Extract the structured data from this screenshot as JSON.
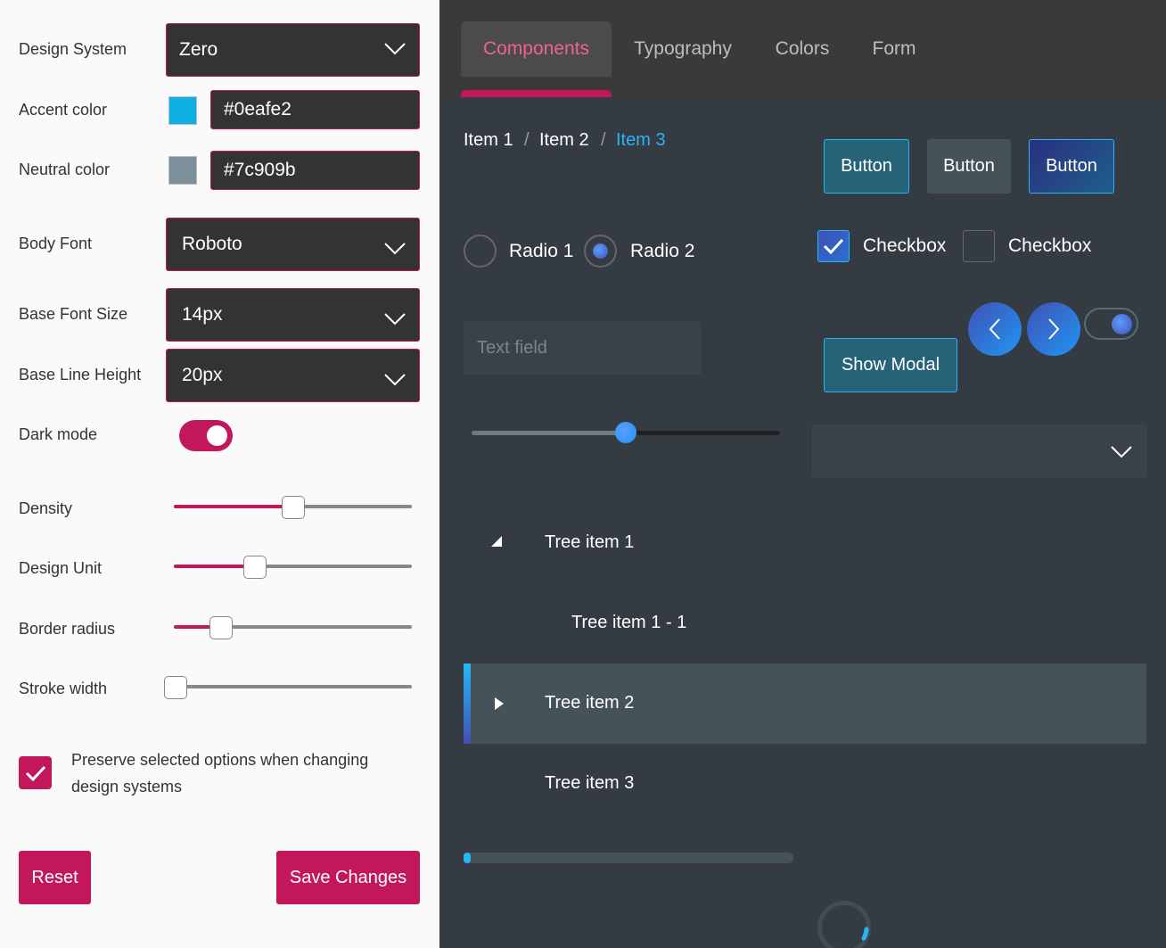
{
  "colors": {
    "accent": "#c2185b",
    "accent_swatch": "#0eafe2",
    "neutral_swatch": "#7c909b",
    "link": "#29b6f6"
  },
  "settings": {
    "design_system": {
      "label": "Design System",
      "value": "Zero"
    },
    "accent_color": {
      "label": "Accent color",
      "value": "#0eafe2"
    },
    "neutral_color": {
      "label": "Neutral color",
      "value": "#7c909b"
    },
    "body_font": {
      "label": "Body Font",
      "value": "Roboto"
    },
    "base_font_size": {
      "label": "Base Font Size",
      "value": "14px"
    },
    "base_line_height": {
      "label": "Base Line Height",
      "value": "20px"
    },
    "dark_mode": {
      "label": "Dark mode",
      "state": "On",
      "on": true
    },
    "density": {
      "label": "Density",
      "level": 0.5
    },
    "design_unit": {
      "label": "Design Unit",
      "level": 0.34
    },
    "border_radius": {
      "label": "Border radius",
      "level": 0.2
    },
    "stroke_width": {
      "label": "Stroke width",
      "level": 0.0
    },
    "preserve": {
      "label": "Preserve selected options when changing design systems",
      "checked": true
    },
    "reset_label": "Reset",
    "save_label": "Save Changes"
  },
  "tabs": [
    {
      "label": "Components",
      "active": true
    },
    {
      "label": "Typography"
    },
    {
      "label": "Colors"
    },
    {
      "label": "Form"
    }
  ],
  "breadcrumb": {
    "items": [
      "Item 1",
      "Item 2",
      "Item 3"
    ],
    "separator": "/"
  },
  "buttons": [
    "Button",
    "Button",
    "Button"
  ],
  "radios": [
    {
      "label": "Radio 1",
      "checked": false
    },
    {
      "label": "Radio 2",
      "checked": true
    }
  ],
  "checkboxes": [
    {
      "label": "Checkbox",
      "checked": true
    },
    {
      "label": "Checkbox",
      "checked": false
    }
  ],
  "text_field": {
    "placeholder": "Text field"
  },
  "show_modal_label": "Show Modal",
  "slider": {
    "level": 0.5
  },
  "tree": [
    {
      "label": "Tree item 1",
      "expanded": true
    },
    {
      "label": "Tree item 1 - 1"
    },
    {
      "label": "Tree item 2",
      "selected": true
    },
    {
      "label": "Tree item 3"
    }
  ],
  "progress": {
    "fraction": 0.02
  },
  "icons": {
    "chevron": "chevron-down-icon",
    "prev": "chevron-left-icon",
    "next": "chevron-right-icon",
    "check": "checkmark-icon",
    "expanded": "triangle-expanded-icon",
    "collapsed": "triangle-collapsed-icon"
  }
}
